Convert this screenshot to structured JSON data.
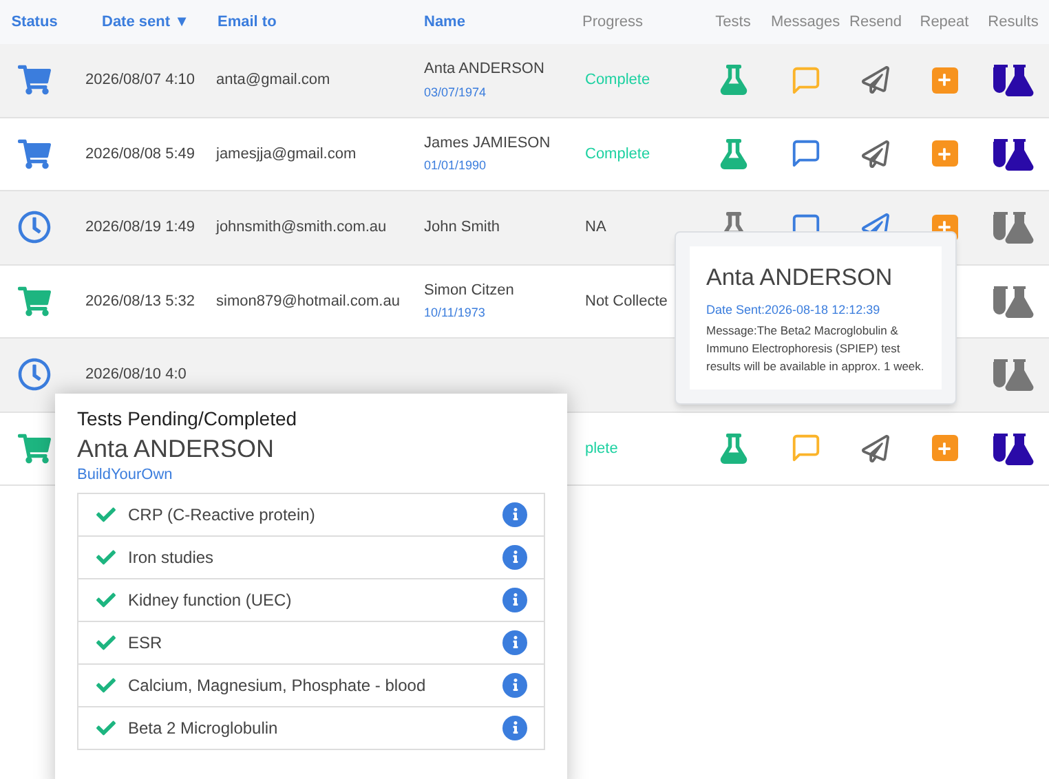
{
  "table": {
    "columns": [
      {
        "label": "Status",
        "sortable": true
      },
      {
        "label": "Date sent",
        "sortable": true,
        "sort_indicator": "▼"
      },
      {
        "label": "Email to",
        "sortable": true
      },
      {
        "label": "Name",
        "sortable": true
      },
      {
        "label": "Progress",
        "sortable": false
      },
      {
        "label": "Tests",
        "sortable": false
      },
      {
        "label": "Messages",
        "sortable": false
      },
      {
        "label": "Resend",
        "sortable": false
      },
      {
        "label": "Repeat",
        "sortable": false
      },
      {
        "label": "Results",
        "sortable": false
      }
    ],
    "rows": [
      {
        "status": {
          "kind": "cart",
          "color": "#3b7ddd"
        },
        "date": "2026/08/07 4:10",
        "email": "anta@gmail.com",
        "name": "Anta ANDERSON",
        "dob": "03/07/1974",
        "progress": {
          "text": "Complete",
          "color": "#1dd1a1"
        },
        "tests": {
          "color": "#1db580"
        },
        "messages": {
          "color": "#fbb42a"
        },
        "resend": {
          "color": "#666666"
        },
        "repeat": {
          "color": "#f7931e"
        },
        "results": {
          "color": "#2a0aa8"
        }
      },
      {
        "status": {
          "kind": "cart",
          "color": "#3b7ddd"
        },
        "date": "2026/08/08 5:49",
        "email": "jamesjja@gmail.com",
        "name": "James JAMIESON",
        "dob": "01/01/1990",
        "progress": {
          "text": "Complete",
          "color": "#1dd1a1"
        },
        "tests": {
          "color": "#1db580"
        },
        "messages": {
          "color": "#3b7ddd"
        },
        "resend": {
          "color": "#666666"
        },
        "repeat": {
          "color": "#f7931e"
        },
        "results": {
          "color": "#2a0aa8"
        }
      },
      {
        "status": {
          "kind": "clock",
          "color": "#3b7ddd"
        },
        "date": "2026/08/19 1:49",
        "email": "johnsmith@smith.com.au",
        "name": "John Smith",
        "progress": {
          "text": "NA",
          "color": "#444444"
        },
        "tests": {
          "color": "#777777"
        },
        "messages": {
          "color": "#3b7ddd"
        },
        "resend": {
          "color": "#3b7ddd"
        },
        "repeat": {
          "color": "#f7931e"
        },
        "results": {
          "color": "#777777"
        }
      },
      {
        "status": {
          "kind": "cart",
          "color": "#1db580"
        },
        "date": "2026/08/13 5:32",
        "email": "simon879@hotmail.com.au",
        "name": "Simon Citzen",
        "dob": "10/11/1973",
        "progress": {
          "text": "Not Collecte",
          "color": "#444444"
        },
        "results": {
          "color": "#777777"
        }
      },
      {
        "status": {
          "kind": "clock",
          "color": "#3b7ddd"
        },
        "date": "2026/08/10 4:0",
        "results": {
          "color": "#777777"
        }
      },
      {
        "status": {
          "kind": "cart",
          "color": "#1db580"
        },
        "progress": {
          "text": "plete",
          "color": "#1dd1a1"
        },
        "tests": {
          "color": "#1db580"
        },
        "messages": {
          "color": "#fbb42a"
        },
        "resend": {
          "color": "#666666"
        },
        "repeat": {
          "color": "#f7931e"
        },
        "results": {
          "color": "#2a0aa8"
        }
      }
    ]
  },
  "message_popover": {
    "name": "Anta ANDERSON",
    "date_sent": "Date Sent:2026-08-18 12:12:39",
    "message": "Message:The Beta2 Macroglobulin & Immuno Electrophoresis (SPIEP) test results will be available in approx. 1 week."
  },
  "tests_card": {
    "title": "Tests Pending/Completed",
    "name": "Anta ANDERSON",
    "package": "BuildYourOwn",
    "tests": [
      {
        "name": "CRP (C-Reactive protein)",
        "completed": true
      },
      {
        "name": "Iron studies",
        "completed": true
      },
      {
        "name": "Kidney function (UEC)",
        "completed": true
      },
      {
        "name": "ESR",
        "completed": true
      },
      {
        "name": "Calcium, Magnesium, Phosphate - blood",
        "completed": true
      },
      {
        "name": "Beta 2 Microglobulin",
        "completed": true
      }
    ]
  }
}
